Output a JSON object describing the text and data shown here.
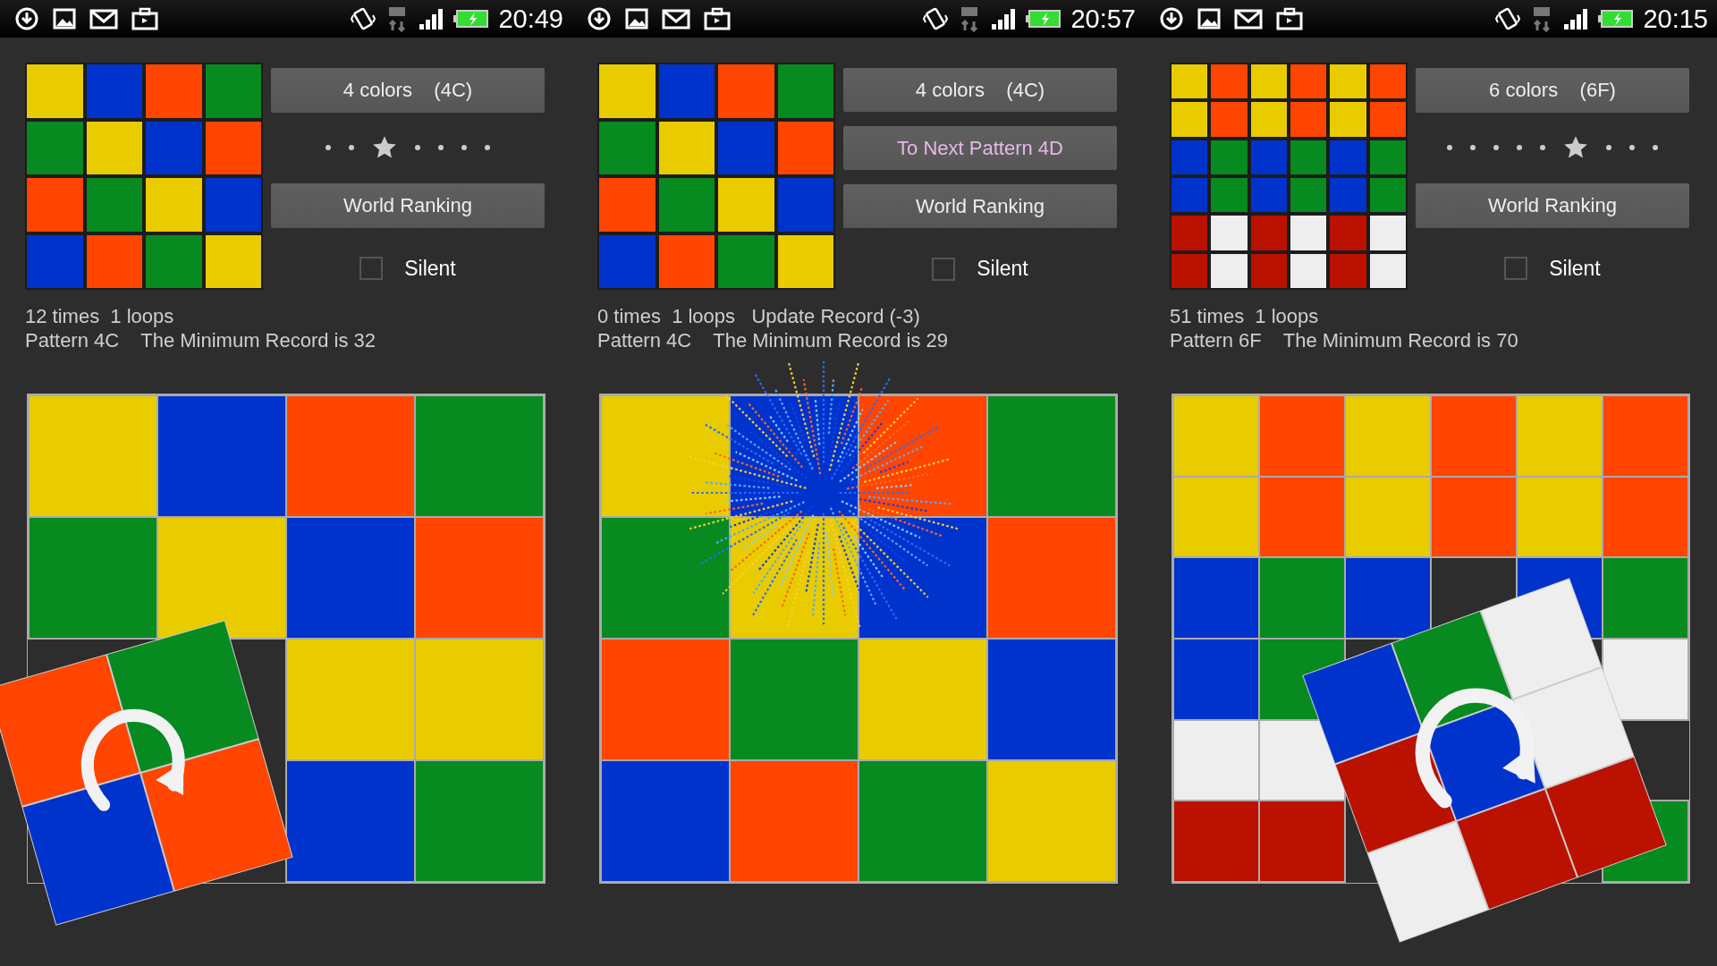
{
  "panels": [
    {
      "status_bar": {
        "time": "20:49"
      },
      "preview": [
        [
          {
            "color": "#e8cc00"
          },
          {
            "color": "#0033cc"
          },
          {
            "color": "#ff4500"
          },
          {
            "color": "#078a1f"
          }
        ],
        [
          {
            "color": "#078a1f"
          },
          {
            "color": "#e8cc00"
          },
          {
            "color": "#0033cc"
          },
          {
            "color": "#ff4500"
          }
        ],
        [
          {
            "color": "#ff4500"
          },
          {
            "color": "#078a1f"
          },
          {
            "color": "#e8cc00"
          },
          {
            "color": "#0033cc"
          }
        ],
        [
          {
            "color": "#0033cc"
          },
          {
            "color": "#ff4500"
          },
          {
            "color": "#078a1f"
          },
          {
            "color": "#e8cc00"
          }
        ]
      ],
      "controls": [
        {
          "kind": "button",
          "label": "4 colors    (4C)"
        },
        {
          "kind": "pager",
          "pages": [
            {
              "selected": false
            },
            {
              "selected": false
            },
            {
              "selected": true
            },
            {
              "selected": false
            },
            {
              "selected": false
            },
            {
              "selected": false
            },
            {
              "selected": false
            }
          ]
        },
        {
          "kind": "button",
          "label": "World Ranking"
        },
        {
          "kind": "checkbox",
          "label": "Silent",
          "checked": false
        }
      ],
      "info": [
        "12 times  1 loops",
        "Pattern 4C    The Minimum Record is 32"
      ],
      "board": [
        [
          {
            "color": "#e8cc00"
          },
          {
            "color": "#0033cc"
          },
          {
            "color": "#ff4500"
          },
          {
            "color": "#078a1f"
          }
        ],
        [
          {
            "color": "#078a1f"
          },
          {
            "color": "#e8cc00"
          },
          {
            "color": "#0033cc"
          },
          {
            "color": "#ff4500"
          }
        ],
        [
          {
            "kind": "hidden"
          },
          {
            "kind": "hidden"
          },
          {
            "color": "#e8cc00"
          },
          {
            "color": "#e8cc00"
          }
        ],
        [
          {
            "kind": "hidden"
          },
          {
            "kind": "hidden"
          },
          {
            "color": "#0033cc"
          },
          {
            "color": "#078a1f"
          }
        ]
      ],
      "piece": {
        "rows": [
          [
            {
              "color": "#ff4500"
            },
            {
              "color": "#078a1f"
            }
          ],
          [
            {
              "color": "#0033cc"
            },
            {
              "color": "#ff4500"
            }
          ]
        ]
      }
    },
    {
      "status_bar": {
        "time": "20:57"
      },
      "preview": [
        [
          {
            "color": "#e8cc00"
          },
          {
            "color": "#0033cc"
          },
          {
            "color": "#ff4500"
          },
          {
            "color": "#078a1f"
          }
        ],
        [
          {
            "color": "#078a1f"
          },
          {
            "color": "#e8cc00"
          },
          {
            "color": "#0033cc"
          },
          {
            "color": "#ff4500"
          }
        ],
        [
          {
            "color": "#ff4500"
          },
          {
            "color": "#078a1f"
          },
          {
            "color": "#e8cc00"
          },
          {
            "color": "#0033cc"
          }
        ],
        [
          {
            "color": "#0033cc"
          },
          {
            "color": "#ff4500"
          },
          {
            "color": "#078a1f"
          },
          {
            "color": "#e8cc00"
          }
        ]
      ],
      "controls": [
        {
          "kind": "button",
          "label": "4 colors    (4C)"
        },
        {
          "kind": "next",
          "label": "To Next Pattern 4D"
        },
        {
          "kind": "button",
          "label": "World Ranking"
        },
        {
          "kind": "checkbox",
          "label": "Silent",
          "checked": false
        }
      ],
      "info": [
        "0 times  1 loops   Update Record (-3)",
        "Pattern 4C    The Minimum Record is 29"
      ],
      "board": [
        [
          {
            "color": "#e8cc00"
          },
          {
            "color": "#0033cc"
          },
          {
            "color": "#ff4500"
          },
          {
            "color": "#078a1f"
          }
        ],
        [
          {
            "color": "#078a1f"
          },
          {
            "color": "#e8cc00"
          },
          {
            "color": "#0033cc"
          },
          {
            "color": "#ff4500"
          }
        ],
        [
          {
            "color": "#ff4500"
          },
          {
            "color": "#078a1f"
          },
          {
            "color": "#e8cc00"
          },
          {
            "color": "#0033cc"
          }
        ],
        [
          {
            "color": "#0033cc"
          },
          {
            "color": "#ff4500"
          },
          {
            "color": "#078a1f"
          },
          {
            "color": "#e8cc00"
          }
        ]
      ],
      "burst": true
    },
    {
      "status_bar": {
        "time": "20:15"
      },
      "preview": [
        [
          {
            "color": "#e8cc00"
          },
          {
            "color": "#ff4500"
          },
          {
            "color": "#e8cc00"
          },
          {
            "color": "#ff4500"
          },
          {
            "color": "#e8cc00"
          },
          {
            "color": "#ff4500"
          }
        ],
        [
          {
            "color": "#e8cc00"
          },
          {
            "color": "#ff4500"
          },
          {
            "color": "#e8cc00"
          },
          {
            "color": "#ff4500"
          },
          {
            "color": "#e8cc00"
          },
          {
            "color": "#ff4500"
          }
        ],
        [
          {
            "color": "#0033cc"
          },
          {
            "color": "#078a1f"
          },
          {
            "color": "#0033cc"
          },
          {
            "color": "#078a1f"
          },
          {
            "color": "#0033cc"
          },
          {
            "color": "#078a1f"
          }
        ],
        [
          {
            "color": "#0033cc"
          },
          {
            "color": "#078a1f"
          },
          {
            "color": "#0033cc"
          },
          {
            "color": "#078a1f"
          },
          {
            "color": "#0033cc"
          },
          {
            "color": "#078a1f"
          }
        ],
        [
          {
            "color": "#bb1100"
          },
          {
            "color": "#eeeeee"
          },
          {
            "color": "#bb1100"
          },
          {
            "color": "#eeeeee"
          },
          {
            "color": "#bb1100"
          },
          {
            "color": "#eeeeee"
          }
        ],
        [
          {
            "color": "#bb1100"
          },
          {
            "color": "#eeeeee"
          },
          {
            "color": "#bb1100"
          },
          {
            "color": "#eeeeee"
          },
          {
            "color": "#bb1100"
          },
          {
            "color": "#eeeeee"
          }
        ]
      ],
      "controls": [
        {
          "kind": "button",
          "label": "6 colors    (6F)"
        },
        {
          "kind": "pager",
          "pages": [
            {
              "selected": false
            },
            {
              "selected": false
            },
            {
              "selected": false
            },
            {
              "selected": false
            },
            {
              "selected": false
            },
            {
              "selected": true
            },
            {
              "selected": false
            },
            {
              "selected": false
            },
            {
              "selected": false
            }
          ]
        },
        {
          "kind": "button",
          "label": "World Ranking"
        },
        {
          "kind": "checkbox",
          "label": "Silent",
          "checked": false
        }
      ],
      "info": [
        "51 times  1 loops",
        "Pattern 6F    The Minimum Record is 70"
      ],
      "board": [
        [
          {
            "color": "#e8cc00"
          },
          {
            "color": "#ff4500"
          },
          {
            "color": "#e8cc00"
          },
          {
            "color": "#ff4500"
          },
          {
            "color": "#e8cc00"
          },
          {
            "color": "#ff4500"
          }
        ],
        [
          {
            "color": "#e8cc00"
          },
          {
            "color": "#ff4500"
          },
          {
            "color": "#e8cc00"
          },
          {
            "color": "#ff4500"
          },
          {
            "color": "#e8cc00"
          },
          {
            "color": "#ff4500"
          }
        ],
        [
          {
            "color": "#0033cc"
          },
          {
            "color": "#078a1f"
          },
          {
            "color": "#0033cc"
          },
          {
            "kind": "hidden"
          },
          {
            "color": "#0033cc"
          },
          {
            "color": "#078a1f"
          }
        ],
        [
          {
            "color": "#0033cc"
          },
          {
            "color": "#078a1f"
          },
          {
            "kind": "hidden"
          },
          {
            "kind": "hidden"
          },
          {
            "kind": "hidden"
          },
          {
            "color": "#eeeeee"
          }
        ],
        [
          {
            "color": "#eeeeee"
          },
          {
            "color": "#eeeeee"
          },
          {
            "kind": "hidden"
          },
          {
            "kind": "hidden"
          },
          {
            "kind": "hidden"
          },
          {
            "kind": "hidden"
          }
        ],
        [
          {
            "color": "#bb1100"
          },
          {
            "color": "#bb1100"
          },
          {
            "kind": "hidden"
          },
          {
            "kind": "hidden"
          },
          {
            "kind": "hidden"
          },
          {
            "color": "#078a1f"
          }
        ]
      ],
      "piece": {
        "rows": [
          [
            {
              "color": "#0033cc"
            },
            {
              "color": "#078a1f"
            },
            {
              "color": "#eeeeee"
            }
          ],
          [
            {
              "color": "#bb1100"
            },
            {
              "color": "#0033cc"
            },
            {
              "color": "#eeeeee"
            }
          ],
          [
            {
              "color": "#eeeeee"
            },
            {
              "color": "#bb1100"
            },
            {
              "color": "#bb1100"
            }
          ]
        ]
      }
    }
  ]
}
